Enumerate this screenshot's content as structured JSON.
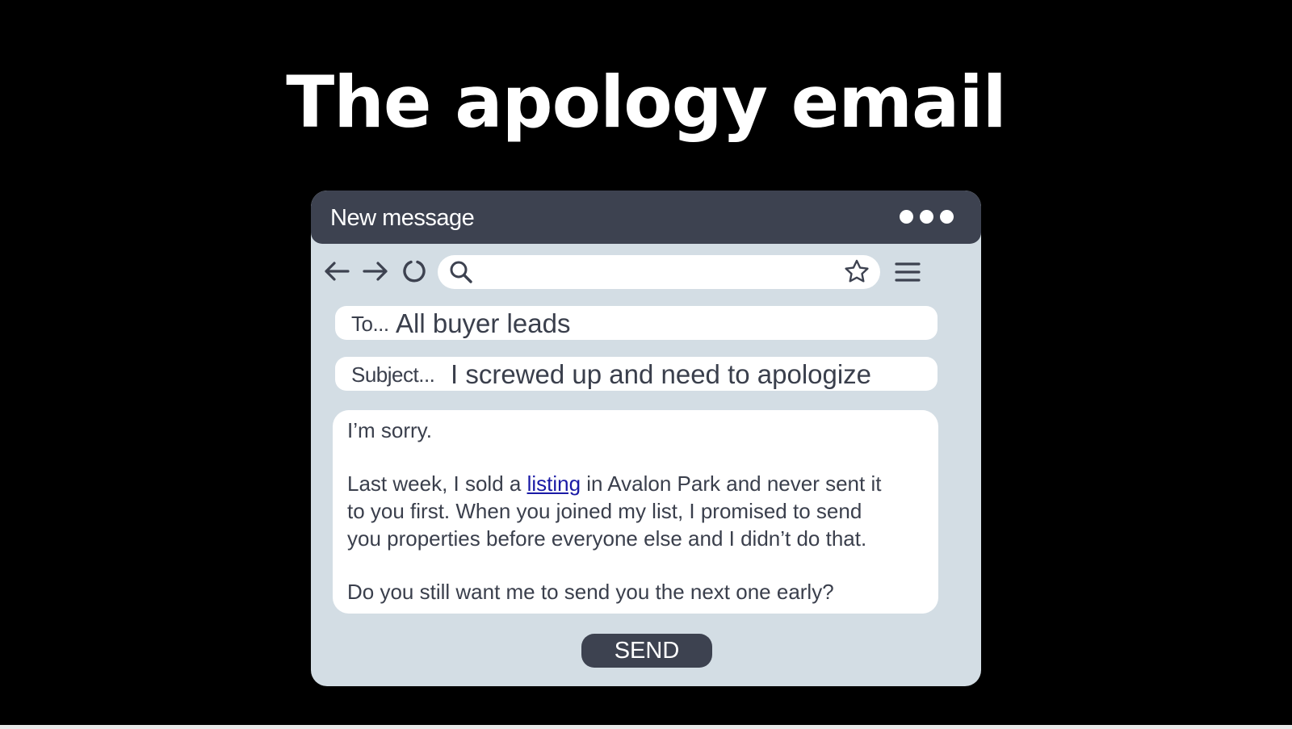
{
  "page": {
    "title": "The apology email"
  },
  "window": {
    "title": "New message",
    "menu_dots": "more-options-icon"
  },
  "toolbar": {
    "icons": [
      "back-arrow-icon",
      "forward-arrow-icon",
      "reload-icon",
      "search-icon",
      "star-icon",
      "hamburger-menu-icon"
    ]
  },
  "compose": {
    "to_label": "To...",
    "to_value": "All buyer leads",
    "subject_label": "Subject...",
    "subject_value": "I screwed up and need to apologize",
    "body": {
      "line1": "I’m sorry.",
      "line2_before": "Last week, I sold a ",
      "line2_link": "listing",
      "line2_after": " in Avalon Park and never sent it",
      "line3": "to you first. When you joined my list, I promised to send",
      "line4": "you properties before everyone else and I didn’t do that.",
      "line5": "Do you still want me to send you the next one early?"
    },
    "send_label": "SEND"
  },
  "colors": {
    "background": "#000000",
    "window": "#d3dde4",
    "titlebar": "#3d4250",
    "text": "#3a3f4c",
    "link": "#1a1aa6"
  }
}
